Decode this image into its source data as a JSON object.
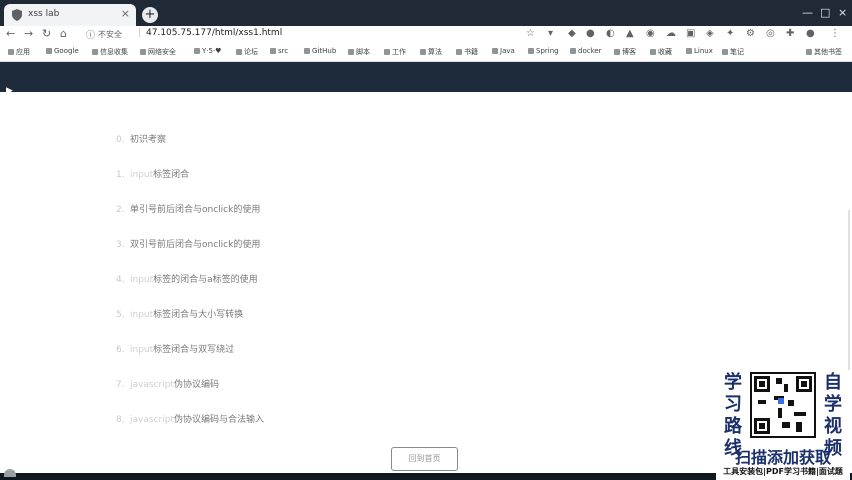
{
  "browser": {
    "tab_title": "xss lab",
    "tab_close": "×",
    "new_tab": "+",
    "window_controls": [
      "—",
      "□",
      "×"
    ],
    "insecure_label": "不安全",
    "separator": "|",
    "url": "47.105.75.177/html/xss1.html"
  },
  "bookmarks": [
    "应用",
    "Google",
    "信息收集",
    "网络安全",
    "Y·5·♥",
    "论坛",
    "src",
    "GitHub",
    "脚本",
    "工作",
    "算法",
    "书籍",
    "Java",
    "Spring",
    "docker",
    "博客",
    "收藏",
    "Linux",
    "笔记",
    "其他书签"
  ],
  "page": {
    "lessons": [
      {
        "num": "0.",
        "tag": "",
        "text": "初识考察"
      },
      {
        "num": "1.",
        "tag": "input",
        "text": "标签闭合"
      },
      {
        "num": "2.",
        "tag": "",
        "text": "单引号前后闭合与onclick的使用"
      },
      {
        "num": "3.",
        "tag": "",
        "text": "双引号前后闭合与onclick的使用"
      },
      {
        "num": "4.",
        "tag": "input",
        "text": "标签的闭合与a标签的使用"
      },
      {
        "num": "5.",
        "tag": "input",
        "text": "标签闭合与大小写转换"
      },
      {
        "num": "6.",
        "tag": "input",
        "text": "标签闭合与双写绕过"
      },
      {
        "num": "7.",
        "tag": "javascript",
        "text": "伪协议编码"
      },
      {
        "num": "8.",
        "tag": "javascript",
        "text": "伪协议编码与合法输入"
      }
    ],
    "home_button": "回到首页"
  },
  "promo": {
    "left_col": [
      "学",
      "习",
      "路",
      "线"
    ],
    "right_col": [
      "自",
      "学",
      "视",
      "频"
    ],
    "scan_text": "扫描添加获取",
    "sub_text": "工具安装包|PDF学习书籍|面试题"
  },
  "colors": {
    "header_bg": "#1d2b3a",
    "promo_blue": "#1a2f6b"
  }
}
